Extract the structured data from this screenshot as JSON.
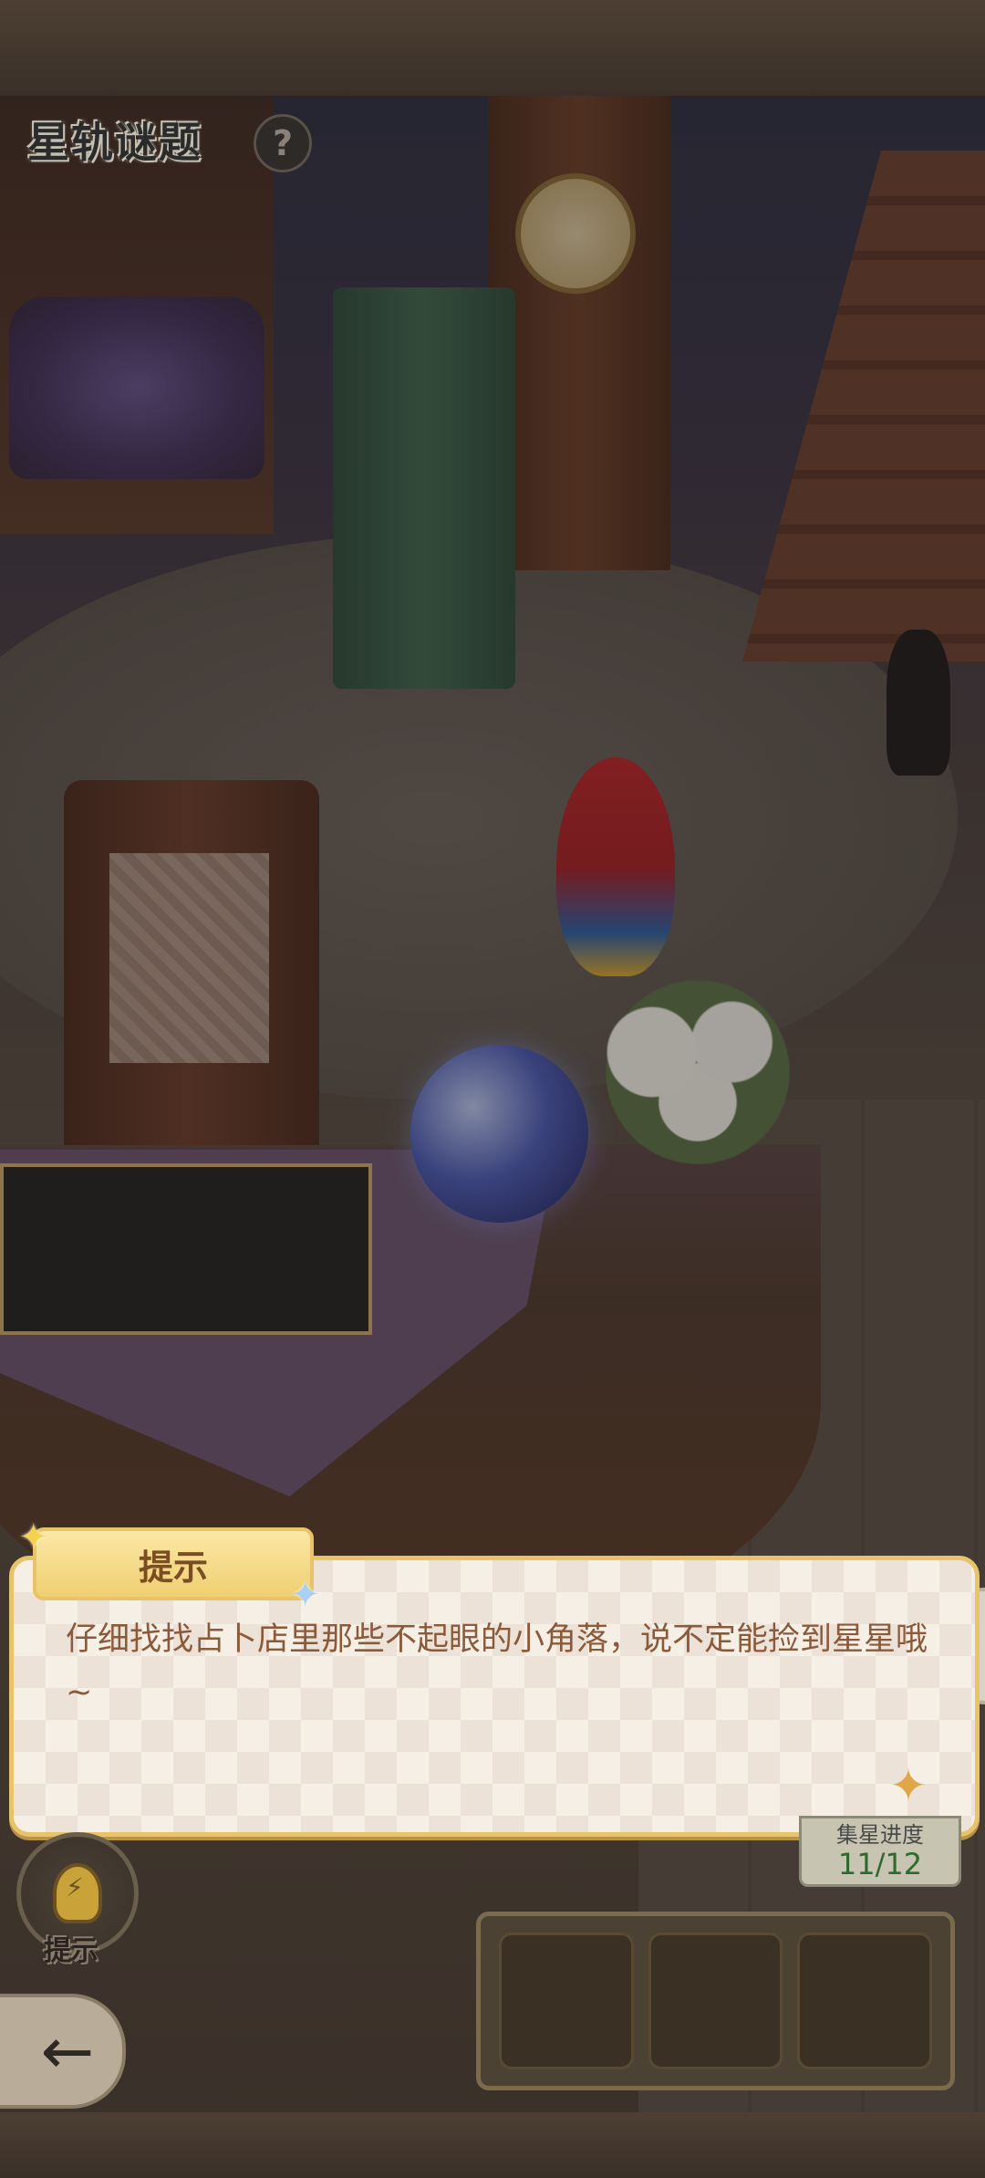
{
  "hud": {
    "title": "星轨谜题",
    "help_icon": "?"
  },
  "hint_dialog": {
    "tab_label": "提示",
    "message": "仔细找找占卜店里那些不起眼的小角落，说不定能捡到星星哦~"
  },
  "collection": {
    "label": "集星进度",
    "value": "11/12"
  },
  "hint_button": {
    "label": "提示"
  },
  "inventory": {
    "slots": 3
  },
  "colors": {
    "hint_border": "#e8c36a",
    "hint_text": "#8a5a3a",
    "progress_text": "#2e6a2e"
  }
}
